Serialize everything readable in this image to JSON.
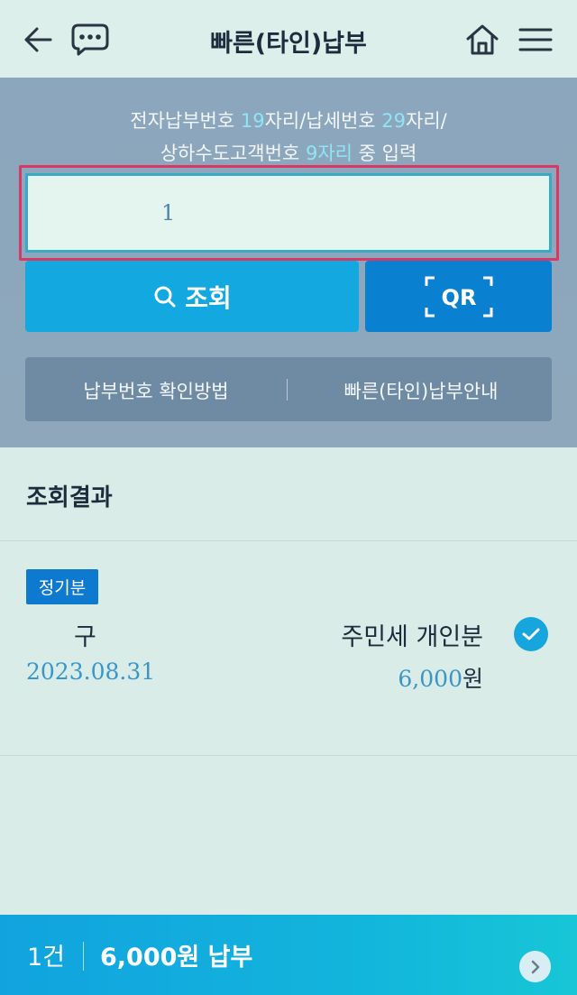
{
  "header": {
    "title": "빠른(타인)납부"
  },
  "guide": {
    "line1": [
      {
        "text": "전자납부번호 ",
        "hl": false
      },
      {
        "text": "19",
        "hl": true
      },
      {
        "text": "자리/납세번호 ",
        "hl": false
      },
      {
        "text": "29",
        "hl": true
      },
      {
        "text": "자리/",
        "hl": false
      }
    ],
    "line2": [
      {
        "text": "상하수도고객번호 ",
        "hl": false
      },
      {
        "text": "9자리",
        "hl": true
      },
      {
        "text": " 중 입력",
        "hl": false
      }
    ]
  },
  "search": {
    "input_value": "1",
    "search_label": "조회",
    "qr_label": "QR"
  },
  "links": {
    "check_method": "납부번호 확인방법",
    "guide": "빠른(타인)납부안내"
  },
  "result": {
    "title": "조회결과",
    "item": {
      "badge": "정기분",
      "region": "구",
      "tax_name": "주민세 개인분",
      "date": "2023.08.31",
      "amount": "6,000",
      "currency": "원",
      "checked": true
    }
  },
  "bottom": {
    "count": "1건",
    "pay_label": "6,000원 납부"
  },
  "colors": {
    "accent": "#13a9e0",
    "qr": "#0a80d0",
    "highlight_border": "#d93865",
    "badge": "#0d79cf"
  }
}
